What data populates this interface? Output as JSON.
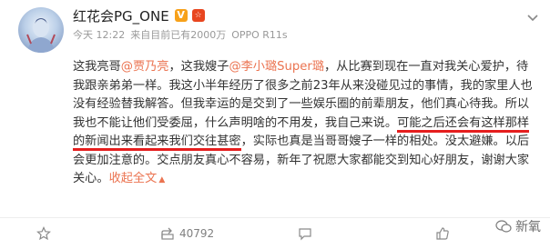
{
  "post": {
    "author": "红花会PG_ONE",
    "verified_badge": "V",
    "level_badge": "☆",
    "time": "今天 12:22",
    "source": "来自",
    "views": "目前已有2000万",
    "device": "OPPO R11s",
    "text": {
      "t1": "这我亮哥",
      "m1": "@贾乃亮",
      "t2": "，这我嫂子",
      "m2": "@李小璐Super璐",
      "t3": "，从比赛到现在一直对我关心爱护，待我跟亲弟弟一样。我这小半年经历了很多之前23年从来没碰见过的事情，我的家里人也没有经验替我解答。但我幸运的是交到了一些娱乐圈的前辈朋友，他们真心待我。所以我也不能让他们受委屈，什么声明啥的不用发，我自己来说。",
      "hl": "可能之后还会有这样那样的新闻出来看起来我们交往甚密",
      "t4": "，实际也真是当哥哥嫂子一样的相处。没太避嫌。以后会更加注意的。交点朋友真心不容易，新年了祝愿大家都能交到知心好朋友，谢谢大家关心。",
      "collapse": "收起全文",
      "collapse_arrow": "▲"
    }
  },
  "footer": {
    "share_count": "40792"
  },
  "watermark": {
    "text": "新氧"
  },
  "colors": {
    "mention": "#eb7350",
    "highlight_underline": "#e51e1e",
    "verified": "#f7a11a"
  }
}
